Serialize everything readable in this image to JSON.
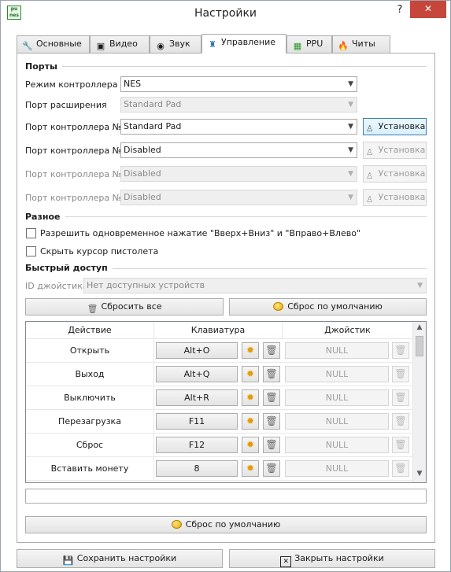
{
  "window": {
    "title": "Настройки",
    "help_glyph": "?",
    "close_glyph": "✕",
    "icon_text_top": "pu",
    "icon_text_bottom": "nes"
  },
  "tabs": [
    {
      "label": "Основные",
      "icon": "wrench-icon",
      "glyph": "🔧"
    },
    {
      "label": "Видео",
      "icon": "monitor-icon",
      "glyph": "▣"
    },
    {
      "label": "Звук",
      "icon": "speaker-icon",
      "glyph": "◉"
    },
    {
      "label": "Управление",
      "icon": "joystick-icon",
      "glyph": "♜"
    },
    {
      "label": "PPU",
      "icon": "chip-icon",
      "glyph": "▦"
    },
    {
      "label": "Читы",
      "icon": "fire-icon",
      "glyph": "🔥"
    }
  ],
  "active_tab": "Управление",
  "ports": {
    "title": "Порты",
    "mode_label": "Режим контроллера",
    "mode_value": "NES",
    "expansion_label": "Порт расширения",
    "expansion_value": "Standard Pad",
    "port1_label": "Порт контроллера №1",
    "port1_value": "Standard Pad",
    "port2_label": "Порт контроллера №2",
    "port2_value": "Disabled",
    "port3_label": "Порт контроллера №3",
    "port3_value": "Disabled",
    "port4_label": "Порт контроллера №4",
    "port4_value": "Disabled",
    "setup_label": "Установка"
  },
  "misc": {
    "title": "Разное",
    "opt1": "Разрешить одновременное нажатие \"Вверх+Вниз\" и \"Вправо+Влево\"",
    "opt2": "Скрыть курсор пистолета"
  },
  "shortcuts": {
    "title": "Быстрый доступ",
    "joystick_id_label": "ID джойстика",
    "joystick_id_value": "Нет доступных устройств",
    "reset_all": "Сбросить все",
    "reset_default": "Сброс по умолчанию",
    "columns": [
      "Действие",
      "Клавиатура",
      "Джойстик"
    ],
    "rows": [
      {
        "action": "Открыть",
        "key": "Alt+O",
        "joy": "NULL"
      },
      {
        "action": "Выход",
        "key": "Alt+Q",
        "joy": "NULL"
      },
      {
        "action": "Выключить",
        "key": "Alt+R",
        "joy": "NULL"
      },
      {
        "action": "Перезагрузка",
        "key": "F11",
        "joy": "NULL"
      },
      {
        "action": "Сброс",
        "key": "F12",
        "joy": "NULL"
      },
      {
        "action": "Вставить монету",
        "key": "8",
        "joy": "NULL"
      }
    ],
    "input_value": "",
    "bottom_reset": "Сброс по умолчанию"
  },
  "footer": {
    "save": "Сохранить настройки",
    "close": "Закрыть настройки"
  },
  "colors": {
    "close_button": "#c7463b",
    "focus_border": "#3c7fb1",
    "gear": "#e59b00"
  }
}
